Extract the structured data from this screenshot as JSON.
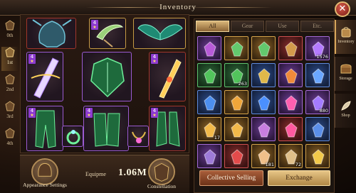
{
  "window": {
    "title": "Inventory",
    "close_icon": "close-icon"
  },
  "levels": [
    {
      "label": "0th",
      "active": false
    },
    {
      "label": "1st",
      "active": true
    },
    {
      "label": "2nd",
      "active": false
    },
    {
      "label": "3rd",
      "active": false
    },
    {
      "label": "4th",
      "active": false
    }
  ],
  "equip_slots": [
    {
      "name": "slot-dragon-helm",
      "quality": "red",
      "plus": ""
    },
    {
      "name": "slot-scythe",
      "quality": "gold",
      "plus": "4",
      "stars": "★"
    },
    {
      "name": "slot-wings",
      "quality": "gold",
      "plus": ""
    },
    {
      "name": "slot-blade-weapon",
      "quality": "purple",
      "plus": "4",
      "stars": "★"
    },
    {
      "name": "slot-chest-armor",
      "quality": "purple",
      "plus": ""
    },
    {
      "name": "slot-golden-dagger",
      "quality": "red",
      "plus": "4",
      "stars": "★"
    },
    {
      "name": "slot-leg-armor",
      "quality": "purple",
      "plus": "4",
      "stars": "★"
    },
    {
      "name": "slot-ring",
      "quality": "purple",
      "plus": ""
    },
    {
      "name": "slot-gloves",
      "quality": "purple",
      "plus": "4",
      "stars": "★"
    },
    {
      "name": "slot-necklace",
      "quality": "purple",
      "plus": ""
    },
    {
      "name": "slot-boots",
      "quality": "red",
      "plus": "4",
      "stars": "★"
    }
  ],
  "bottom": {
    "appearance_label": "Appearance Settings",
    "equip_label": "Equipme",
    "equip_value": "1.06M",
    "constellation_label": "Constellation"
  },
  "inventory": {
    "tabs": [
      {
        "label": "All",
        "active": true
      },
      {
        "label": "Gear",
        "active": false
      },
      {
        "label": "Use",
        "active": false
      },
      {
        "label": "Etc.",
        "active": false
      }
    ],
    "items": [
      {
        "icon": "purple-spellbook-icon",
        "quality": "purple",
        "count": "",
        "color": "#b85bd8"
      },
      {
        "icon": "green-crossbow-icon",
        "quality": "gold",
        "count": "",
        "color": "#63c96d"
      },
      {
        "icon": "green-crossbow-icon",
        "quality": "gold",
        "count": "",
        "color": "#63c96d"
      },
      {
        "icon": "treasure-chest-icon",
        "quality": "red",
        "count": "",
        "color": "#d49a4c"
      },
      {
        "icon": "purple-gem-chest-icon",
        "quality": "purple",
        "count": "1576",
        "color": "#b57bff"
      },
      {
        "icon": "green-potion-icon",
        "quality": "green",
        "count": "",
        "color": "#52c45c"
      },
      {
        "icon": "green-potion-icon",
        "quality": "green",
        "count": "263",
        "color": "#52c45c"
      },
      {
        "icon": "gold-ring-icon",
        "quality": "blue",
        "count": "",
        "color": "#e0b84a"
      },
      {
        "icon": "orange-orb-icon",
        "quality": "purple",
        "count": "",
        "color": "#f08a3a"
      },
      {
        "icon": "blue-crystal-icon",
        "quality": "blue",
        "count": "",
        "color": "#6aa7ff"
      },
      {
        "icon": "blue-shard-icon",
        "quality": "blue",
        "count": "",
        "color": "#4c8ff0"
      },
      {
        "icon": "amber-block-icon",
        "quality": "gold",
        "count": "",
        "color": "#f0a63a"
      },
      {
        "icon": "blue-crescent-icon",
        "quality": "blue",
        "count": "",
        "color": "#4b90ff"
      },
      {
        "icon": "pink-diamond-icon",
        "quality": "purple",
        "count": "",
        "color": "#ff5fb0"
      },
      {
        "icon": "purple-crystal-icon",
        "quality": "purple",
        "count": "880",
        "color": "#a47bff"
      },
      {
        "icon": "gold-feather-icon",
        "quality": "gold",
        "count": "17",
        "color": "#f2b94a"
      },
      {
        "icon": "gold-feather-icon",
        "quality": "gold",
        "count": "",
        "color": "#f2b94a"
      },
      {
        "icon": "rune-coin-icon",
        "quality": "purple",
        "count": "",
        "color": "#c77ee0"
      },
      {
        "icon": "pink-gem-pendant-icon",
        "quality": "red",
        "count": "",
        "color": "#ff5aa0"
      },
      {
        "icon": "blue-cluster-icon",
        "quality": "blue",
        "count": "",
        "color": "#5b8fe8"
      },
      {
        "icon": "dark-helm-icon",
        "quality": "purple",
        "count": "",
        "color": "#9e7bd8"
      },
      {
        "icon": "red-scepter-icon",
        "quality": "red",
        "count": "",
        "color": "#e34b4b"
      },
      {
        "icon": "horn-icon",
        "quality": "gold",
        "count": "181",
        "color": "#f0c08a"
      },
      {
        "icon": "scroll-icon",
        "quality": "gold",
        "count": "72",
        "color": "#e0c08a"
      },
      {
        "icon": "gold-staff-icon",
        "quality": "gold",
        "count": "",
        "color": "#f2c94a"
      }
    ]
  },
  "actions": {
    "collective_selling": "Collective Selling",
    "exchange": "Exchange"
  },
  "side_tabs": [
    {
      "label": "Inventory",
      "icon": "backpack-icon",
      "active": true
    },
    {
      "label": "Storage",
      "icon": "chest-icon",
      "active": false
    },
    {
      "label": "Shop",
      "icon": "shop-icon",
      "active": false
    }
  ]
}
